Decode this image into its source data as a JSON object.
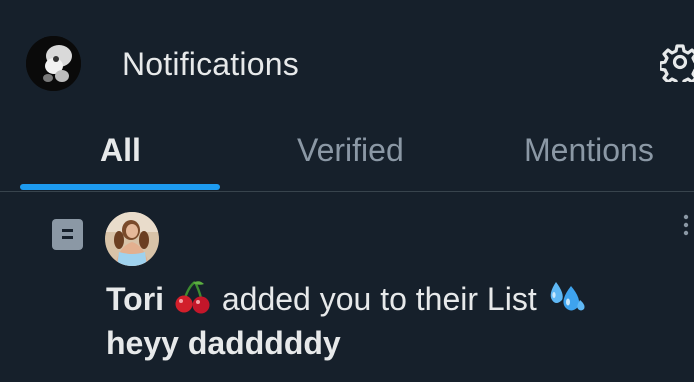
{
  "header": {
    "title": "Notifications",
    "avatar_icon": "profile-avatar",
    "settings_icon": "gear-icon"
  },
  "tabs": [
    {
      "label": "All",
      "active": true
    },
    {
      "label": "Verified",
      "active": false
    },
    {
      "label": "Mentions",
      "active": false
    }
  ],
  "notification": {
    "type_icon": "list-icon",
    "user_name": "Tori",
    "name_emoji": "cherries",
    "action_text": "added you to their List",
    "action_emoji": "sweat-droplets",
    "list_name": "heyy dadddddy"
  },
  "colors": {
    "background": "#16202b",
    "accent": "#1d9bf0",
    "text_primary": "#e7e9ea",
    "text_secondary": "#8b98a5",
    "divider": "#38444d"
  }
}
